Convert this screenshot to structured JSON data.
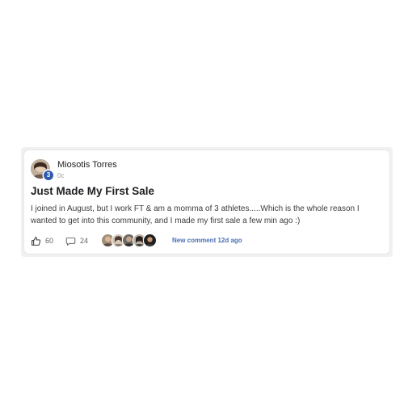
{
  "post": {
    "author": {
      "name": "Miosotis Torres",
      "level": "3",
      "timestamp": "0c"
    },
    "title": "Just Made My First Sale",
    "body": "I joined in August, but I work FT & am a momma of 3 athletes.....Which is the whole reason I wanted to get into this community, and I made my first sale a few min ago :)",
    "likes": "60",
    "comments": "24",
    "new_comment_label": "New comment 12d ago",
    "icons": {
      "like": "thumbs-up-icon",
      "comment": "comment-bubble-icon"
    },
    "colors": {
      "badge": "#2f5ab0",
      "link": "#4a6fb5"
    }
  }
}
